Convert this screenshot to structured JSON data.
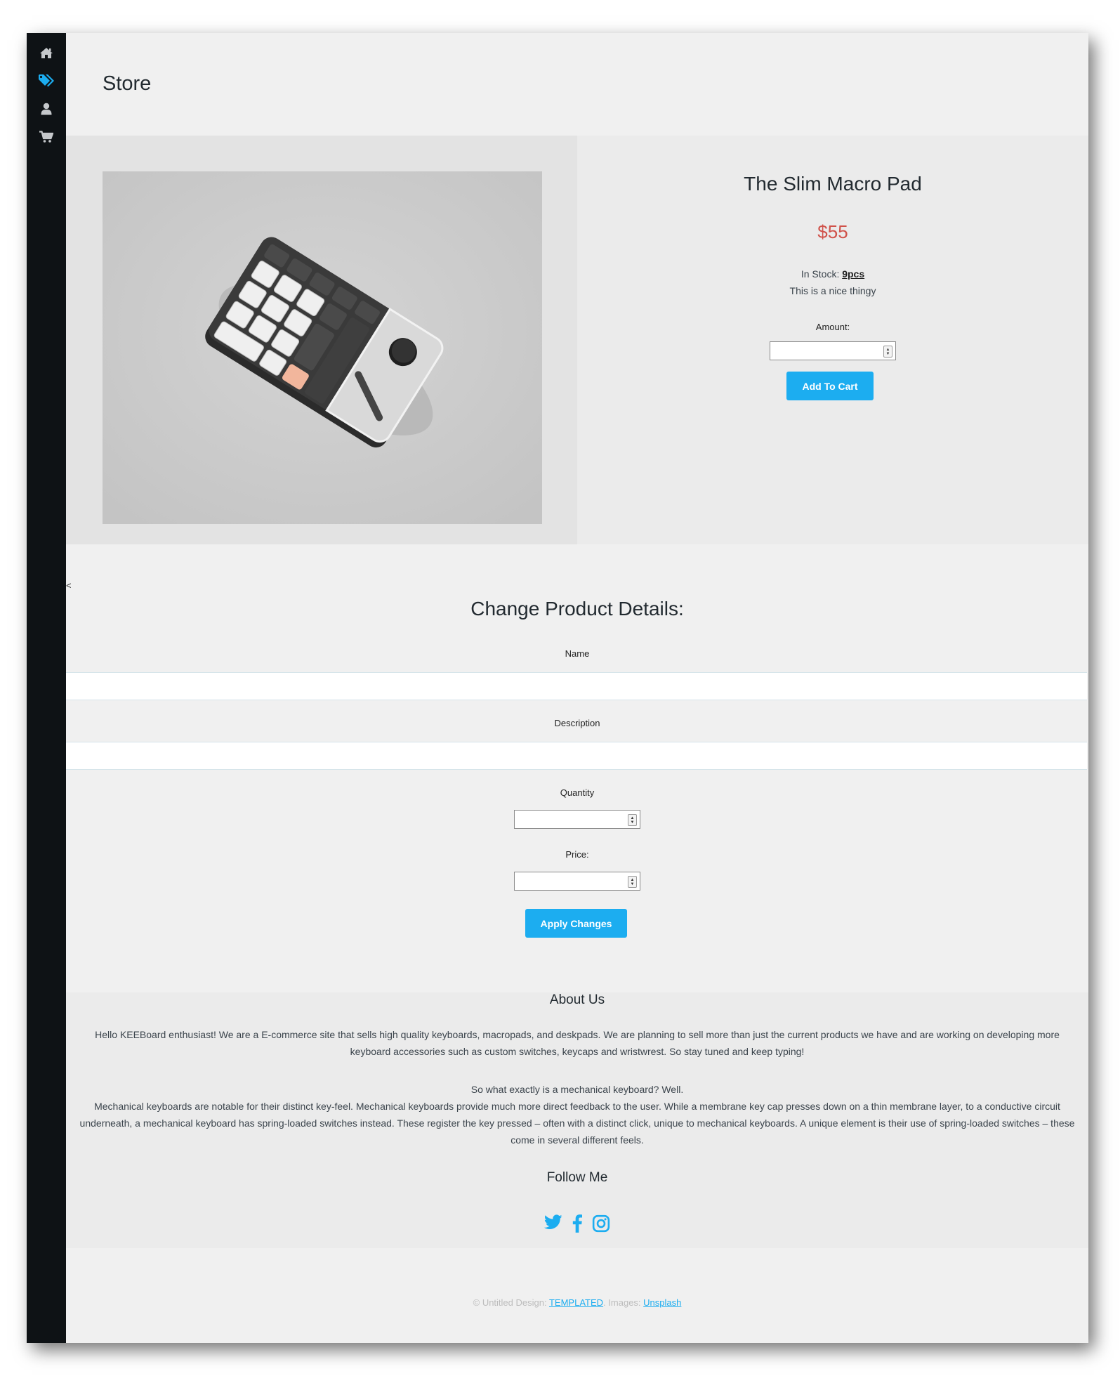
{
  "sidebar": {
    "items": [
      {
        "icon": "home-icon",
        "label": "Home",
        "active": false
      },
      {
        "icon": "tags-icon",
        "label": "Store",
        "active": true
      },
      {
        "icon": "user-icon",
        "label": "Account",
        "active": false
      },
      {
        "icon": "cart-icon",
        "label": "Cart",
        "active": false
      }
    ],
    "active_color": "#1cadf0",
    "icon_color": "#c5c8cb"
  },
  "page": {
    "title": "Store"
  },
  "product": {
    "name": "The Slim Macro Pad",
    "price": "$55",
    "stock_label": "In Stock:",
    "stock_value": "9pcs",
    "description": "This is a nice thingy",
    "amount_label": "Amount:",
    "amount_value": "",
    "add_to_cart_label": "Add To Cart",
    "image": {
      "subject": "macro-pad-keyboard"
    }
  },
  "edit_form": {
    "back_glyph": "<",
    "title": "Change Product Details:",
    "name_label": "Name",
    "name_value": "",
    "description_label": "Description",
    "description_value": "",
    "quantity_label": "Quantity",
    "quantity_value": "",
    "price_label": "Price:",
    "price_value": "",
    "apply_label": "Apply Changes"
  },
  "about": {
    "title": "About Us",
    "paragraph1": "Hello KEEBoard enthusiast! We are a E-commerce site that sells high quality keyboards, macropads, and deskpads. We are planning to sell more than just the current products we have and are working on developing more keyboard accessories such as custom switches, keycaps and wristwrest. So stay tuned and keep typing!",
    "paragraph2_intro": "So what exactly is a mechanical keyboard? Well.",
    "paragraph2": "Mechanical keyboards are notable for their distinct key-feel. Mechanical keyboards provide much more direct feedback to the user. While a membrane key cap presses down on a thin membrane layer, to a conductive circuit underneath, a mechanical keyboard has spring-loaded switches instead. These register the key pressed – often with a distinct click, unique to mechanical keyboards. A unique element is their use of spring-loaded switches – these come in several different feels.",
    "follow_title": "Follow Me",
    "social": [
      "twitter-icon",
      "facebook-icon",
      "instagram-icon"
    ]
  },
  "footer": {
    "prefix": "© Untitled Design:",
    "design_link": "TEMPLATED",
    "images_label": "Images:",
    "images_link": "Unsplash"
  },
  "colors": {
    "accent": "#1cadf0",
    "price": "#d0524a",
    "sidebar_bg": "#0e1215"
  }
}
